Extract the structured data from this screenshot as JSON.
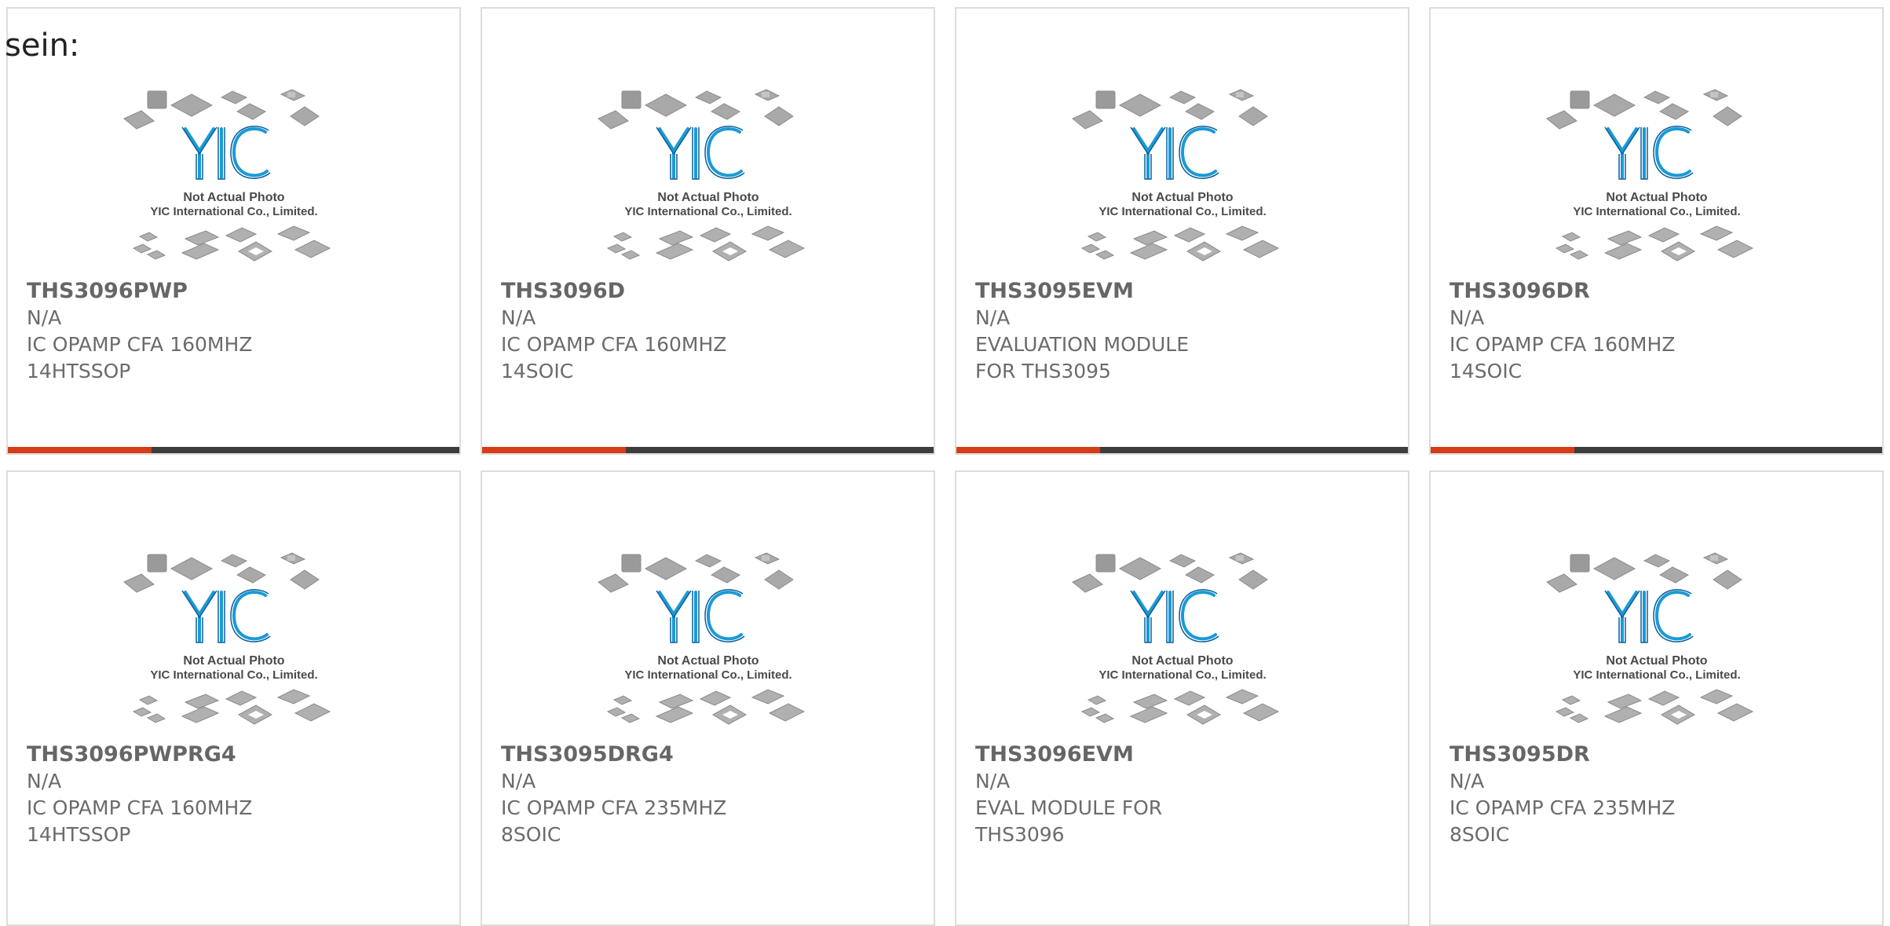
{
  "intro_text": "sein:",
  "colors": {
    "accent": "#d63c17",
    "bar": "#3d3d3d",
    "border": "#dcdcdc",
    "text": "#6b6b6b",
    "logo_blue": "#1a9ad6"
  },
  "placeholder": {
    "line1": "Not Actual Photo",
    "line2": "YIC International Co., Limited.",
    "logo_text": "YIC",
    "icon": "chip-packages-placeholder-icon"
  },
  "products": [
    {
      "part": "THS3096PWP",
      "status": "N/A",
      "desc": "IC OPAMP CFA 160MHZ 14HTSSOP"
    },
    {
      "part": "THS3096D",
      "status": "N/A",
      "desc": "IC OPAMP CFA 160MHZ 14SOIC"
    },
    {
      "part": "THS3095EVM",
      "status": "N/A",
      "desc": "EVALUATION MODULE FOR THS3095"
    },
    {
      "part": "THS3096DR",
      "status": "N/A",
      "desc": "IC OPAMP CFA 160MHZ 14SOIC"
    },
    {
      "part": "THS3096PWPRG4",
      "status": "N/A",
      "desc": "IC OPAMP CFA 160MHZ 14HTSSOP"
    },
    {
      "part": "THS3095DRG4",
      "status": "N/A",
      "desc": "IC OPAMP CFA 235MHZ 8SOIC"
    },
    {
      "part": "THS3096EVM",
      "status": "N/A",
      "desc": "EVAL MODULE FOR THS3096"
    },
    {
      "part": "THS3095DR",
      "status": "N/A",
      "desc": "IC OPAMP CFA 235MHZ 8SOIC"
    }
  ]
}
